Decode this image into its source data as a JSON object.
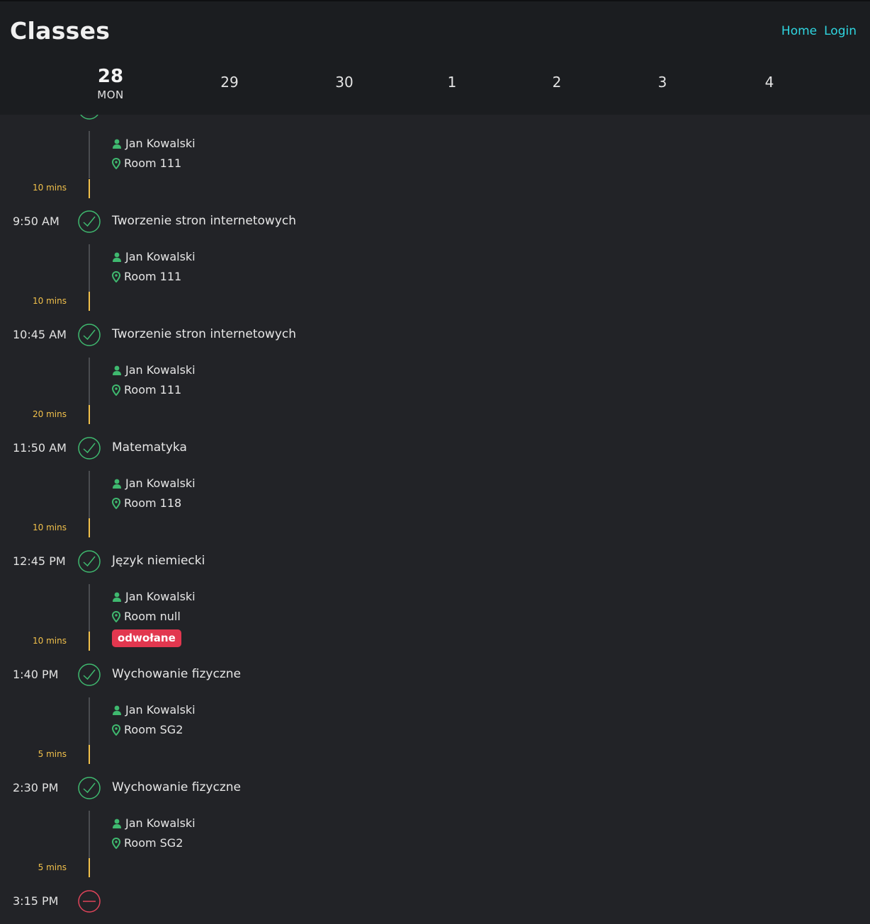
{
  "header": {
    "title": "Classes",
    "nav": [
      "Home",
      "Login"
    ]
  },
  "days": [
    {
      "num": "28",
      "label": "MON",
      "active": true
    },
    {
      "num": "29"
    },
    {
      "num": "30"
    },
    {
      "num": "1"
    },
    {
      "num": "2"
    },
    {
      "num": "3"
    },
    {
      "num": "4"
    }
  ],
  "partial_lesson": {
    "teacher": "Jan Kowalski",
    "room": "Room 111",
    "break_after": "10 mins"
  },
  "lessons": [
    {
      "time": "9:50 AM",
      "subject": "Tworzenie stron internetowych",
      "teacher": "Jan Kowalski",
      "room": "Room 111",
      "status": "done",
      "break_after": "10 mins"
    },
    {
      "time": "10:45 AM",
      "subject": "Tworzenie stron internetowych",
      "teacher": "Jan Kowalski",
      "room": "Room 111",
      "status": "done",
      "break_after": "20 mins"
    },
    {
      "time": "11:50 AM",
      "subject": "Matematyka",
      "teacher": "Jan Kowalski",
      "room": "Room 118",
      "status": "done",
      "break_after": "10 mins"
    },
    {
      "time": "12:45 PM",
      "subject": "Język niemiecki",
      "teacher": "Jan Kowalski",
      "room": "Room null",
      "status": "done",
      "badge": "odwołane",
      "break_after": "10 mins"
    },
    {
      "time": "1:40 PM",
      "subject": "Wychowanie fizyczne",
      "teacher": "Jan Kowalski",
      "room": "Room SG2",
      "status": "done",
      "break_after": "5 mins"
    },
    {
      "time": "2:30 PM",
      "subject": "Wychowanie fizyczne",
      "teacher": "Jan Kowalski",
      "room": "Room SG2",
      "status": "done",
      "break_after": "5 mins"
    },
    {
      "time": "3:15 PM",
      "subject": "",
      "status": "cancelled"
    }
  ],
  "colors": {
    "accent": "#2fd6e0",
    "done": "#3fb96f",
    "cancelled": "#e0445a",
    "break": "#f2c14b",
    "badge": "#e2374f"
  },
  "icons": {
    "teacher": "person-icon",
    "room": "map-pin-icon",
    "done": "check-circle-icon",
    "cancelled": "minus-circle-icon"
  }
}
